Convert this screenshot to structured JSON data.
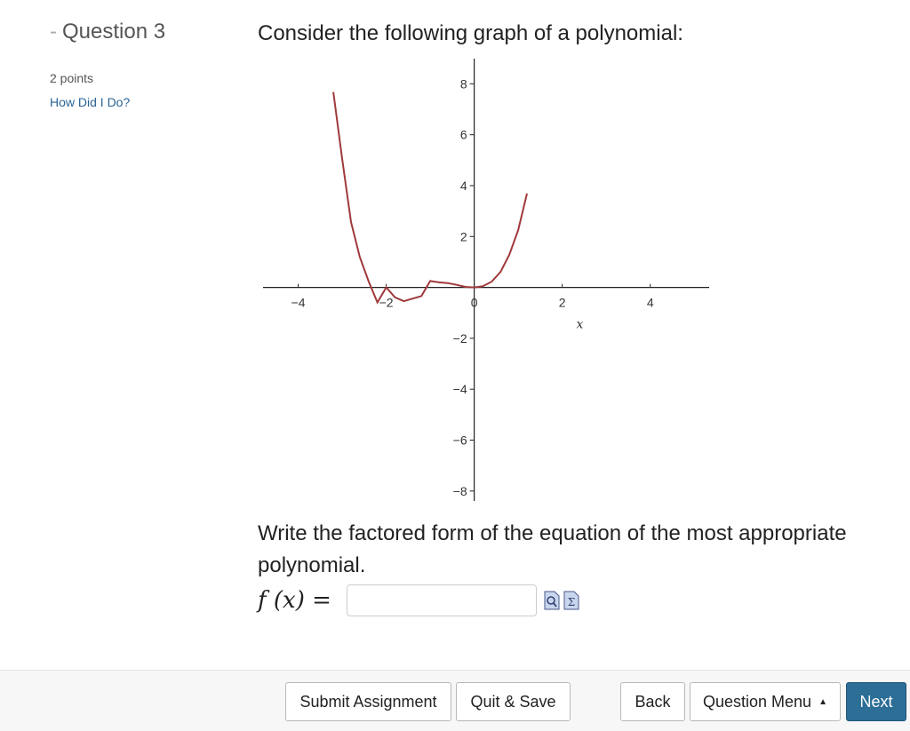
{
  "question": {
    "dash": "-",
    "title": "Question 3",
    "points": "2 points",
    "help_link": "How Did I Do?",
    "prompt": "Consider the following graph of a polynomial:",
    "instructions": "Write the factored form of the equation of the most appropriate polynomial.",
    "answer_label": "f (x) =",
    "answer_value": "",
    "tool_icons": [
      "preview-icon",
      "math-palette-icon"
    ]
  },
  "chart_data": {
    "type": "line",
    "function": "f(x) = x^2 (x + 2)^2 / 4",
    "series": [
      {
        "x": [
          -3.2,
          -3.0,
          -2.8,
          -2.6,
          -2.4,
          -2.2,
          -2.0,
          -1.8,
          -1.6,
          -1.4,
          -1.2,
          -1.0,
          -0.8,
          -0.6,
          -0.4,
          -0.2,
          0.0,
          0.2,
          0.4,
          0.6,
          0.8,
          1.0,
          1.2
        ],
        "y": [
          7.68,
          5.06,
          2.57,
          1.19,
          0.24,
          -0.59,
          0.0,
          -0.39,
          -0.54,
          -0.44,
          -0.34,
          0.25,
          0.2,
          0.17,
          0.1,
          0.02,
          0.0,
          0.05,
          0.23,
          0.61,
          1.29,
          2.25,
          3.69
        ]
      }
    ],
    "xlabel": "x",
    "ylabel": "",
    "xlim": [
      -5,
      5.5
    ],
    "ylim": [
      -8.6,
      9.2
    ],
    "xticks": [
      -4,
      -2,
      0,
      2,
      4
    ],
    "yticks": [
      -8,
      -6,
      -4,
      -2,
      2,
      4,
      6,
      8
    ],
    "line_color": "#a0393b",
    "grid": false
  },
  "buttons": {
    "submit": "Submit Assignment",
    "quit": "Quit & Save",
    "back": "Back",
    "menu": "Question Menu",
    "menu_caret": "▲",
    "next": "Next"
  },
  "colors": {
    "link": "#2a6496",
    "next_button": "#2c6e96"
  }
}
